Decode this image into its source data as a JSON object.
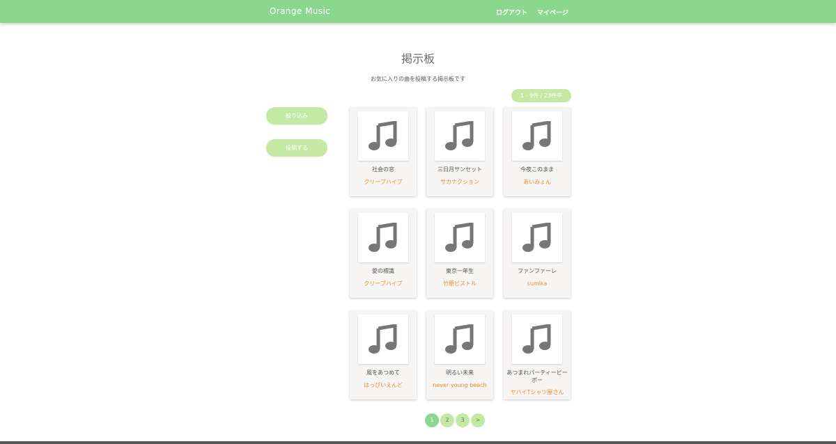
{
  "header": {
    "brand": "Orange Music",
    "nav": {
      "logout": "ログアウト",
      "mypage": "マイページ"
    }
  },
  "main": {
    "title": "掲示板",
    "description": "お気に入りの曲を投稿する掲示板です",
    "count": "1 - 9件 / 23件中"
  },
  "sidebar": {
    "filter_label": "絞り込み",
    "post_label": "投稿する"
  },
  "posts": [
    {
      "song": "社会の窓",
      "artist": "クリープハイプ",
      "icon": "music-note-icon"
    },
    {
      "song": "三日月サンセット",
      "artist": "サカナクション",
      "icon": "music-note-icon"
    },
    {
      "song": "今夜このまま",
      "artist": "あいみょん",
      "icon": "music-note-icon"
    },
    {
      "song": "愛の標識",
      "artist": "クリープハイプ",
      "icon": "music-note-icon"
    },
    {
      "song": "東京一年生",
      "artist": "竹原ピストル",
      "icon": "music-note-icon"
    },
    {
      "song": "ファンファーレ",
      "artist": "sumika",
      "icon": "music-note-icon"
    },
    {
      "song": "風をあつめて",
      "artist": "はっぴいえんど",
      "icon": "music-note-icon"
    },
    {
      "song": "明るい未来",
      "artist": "never young beach",
      "icon": "music-note-icon"
    },
    {
      "song": "あつまれパーティーピーポー",
      "artist": "ヤバイTシャツ屋さん",
      "icon": "music-note-icon"
    }
  ],
  "pagination": {
    "pages": [
      "1",
      "2",
      "3"
    ],
    "next": ">",
    "current": "1"
  },
  "colors": {
    "header": "#8cd78f",
    "pill": "#c4e9a4",
    "artist": "#f0892a",
    "card": "#f6f5f4"
  }
}
